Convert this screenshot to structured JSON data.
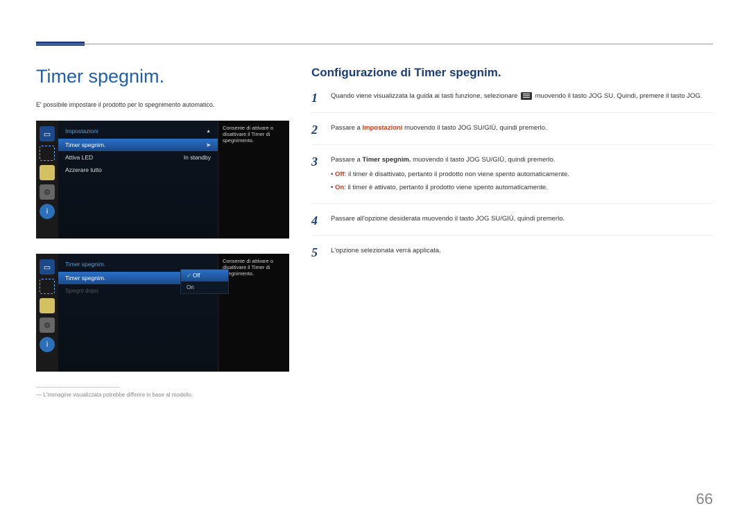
{
  "page": {
    "number": "66",
    "footnote": "― L'immagine visualizzata potrebbe differire in base al modello."
  },
  "headings": {
    "main": "Timer spegnim.",
    "intro": "E' possibile impostare il prodotto per lo spegnimento automatico.",
    "config": "Configurazione di Timer spegnim."
  },
  "osd1": {
    "title": "Impostazioni",
    "rows": [
      {
        "label": "Timer spegnim.",
        "value": ""
      },
      {
        "label": "Attiva LED",
        "value": "In standby"
      },
      {
        "label": "Azzerare tutto",
        "value": ""
      }
    ],
    "desc": "Consente di attivare o disattivare il Timer di spegnimento."
  },
  "osd2": {
    "title": "Timer spegnim.",
    "rows": [
      {
        "label": "Timer spegnim.",
        "value": ""
      },
      {
        "label": "Spegni dopo",
        "value": ""
      }
    ],
    "options": [
      "Off",
      "On"
    ],
    "desc": "Consente di attivare o disattivare il Timer di spegnimento."
  },
  "steps": {
    "s1a": "Quando viene visualizzata la guida ai tasti funzione, selezionare ",
    "s1b": " muovendo il tasto JOG SU. Quindi, premere il tasto JOG.",
    "s2a": "Passare a ",
    "s2link": "Impostazioni",
    "s2b": " muovendo il tasto JOG SU/GIÙ, quindi premerlo.",
    "s3a": "Passare a ",
    "s3bold": "Timer spegnim.",
    "s3b": " muovendo il tasto JOG SU/GIÙ, quindi premerlo.",
    "s3offlabel": "Off",
    "s3offdesc": ": il timer è disattivato, pertanto il prodotto non viene spento automaticamente.",
    "s3onlabel": "On",
    "s3ondesc": ": il timer è attivato, pertanto il prodotto viene spento automaticamente.",
    "s4": "Passare all'opzione desiderata muovendo il tasto JOG SU/GIÙ, quindi premerlo.",
    "s5": "L'opzione selezionata verrà applicata."
  }
}
